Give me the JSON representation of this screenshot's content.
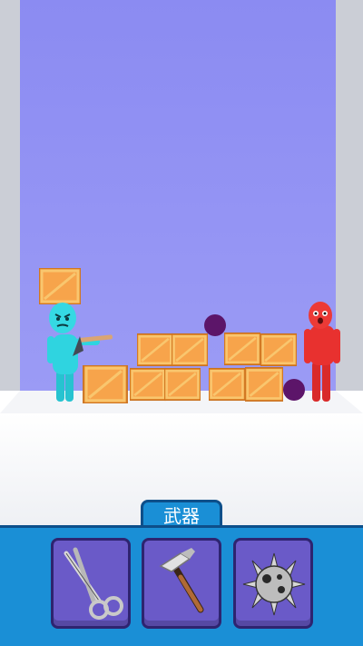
{
  "weapons_panel": {
    "tab_label": "武器",
    "slots": [
      {
        "icon": "scissors-icon"
      },
      {
        "icon": "hammer-icon"
      },
      {
        "icon": "spiked-ball-icon"
      }
    ]
  },
  "colors": {
    "sky": "#8f8ff2",
    "player": "#2fd4e0",
    "enemy": "#e8312f",
    "crate": "#f7a44b",
    "panel": "#1a8fd6",
    "slot": "#6a5ac8"
  }
}
